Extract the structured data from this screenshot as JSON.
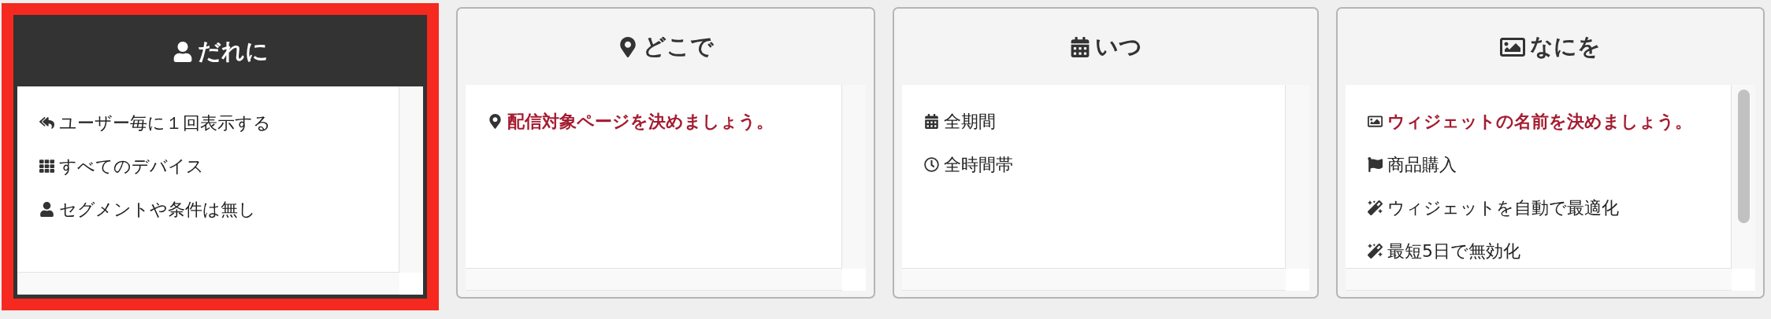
{
  "cards": [
    {
      "title": "だれに",
      "kind": "user",
      "selected": true,
      "scrollbar": false,
      "items": [
        {
          "text": "ユーザー毎に１回表示する",
          "kind": "reply",
          "required": false
        },
        {
          "text": "すべてのデバイス",
          "kind": "grid",
          "required": false
        },
        {
          "text": "セグメントや条件は無し",
          "kind": "user",
          "required": false
        }
      ]
    },
    {
      "title": "どこで",
      "kind": "pin",
      "selected": false,
      "scrollbar": false,
      "items": [
        {
          "text": "配信対象ページを決めましょう。",
          "kind": "pin",
          "required": true
        }
      ]
    },
    {
      "title": "いつ",
      "kind": "calendar",
      "selected": false,
      "scrollbar": false,
      "items": [
        {
          "text": "全期間",
          "kind": "calendar",
          "required": false
        },
        {
          "text": "全時間帯",
          "kind": "clock",
          "required": false
        }
      ]
    },
    {
      "title": "なにを",
      "kind": "picture",
      "selected": false,
      "scrollbar": true,
      "items": [
        {
          "text": "ウィジェットの名前を決めましょう。",
          "kind": "picture",
          "required": true
        },
        {
          "text": "商品購入",
          "kind": "flag",
          "required": false
        },
        {
          "text": "ウィジェットを自動で最適化",
          "kind": "magic",
          "required": false
        },
        {
          "text": "最短5日で無効化",
          "kind": "magic",
          "required": false
        }
      ]
    }
  ]
}
